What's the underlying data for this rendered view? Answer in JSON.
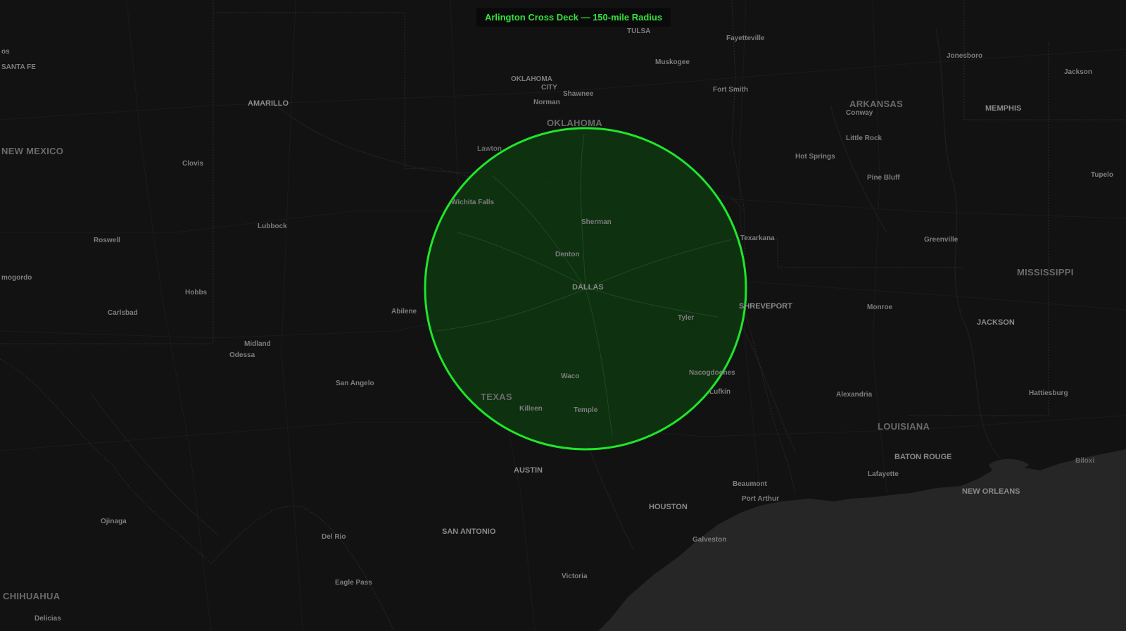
{
  "map": {
    "title": "Arlington Cross Deck — 150-mile Radius",
    "radius_label": "150-mile Radius",
    "center_place": "Arlington",
    "colors": {
      "background": "#121212",
      "gulf_water": "#2a2a2a",
      "circle_stroke": "#1fe62a",
      "circle_fill": "#0d3a0f",
      "title_text": "#35e23c",
      "label_text": "#7d7d7d"
    },
    "state_labels": {
      "new_mexico": "NEW MEXICO",
      "oklahoma": "OKLAHOMA",
      "arkansas": "ARKANSAS",
      "mississippi": "MISSISSIPPI",
      "texas": "TEXAS",
      "louisiana": "LOUISIANA",
      "chihuahua": "CHIHUAHUA"
    },
    "city_labels": {
      "santa_fe": "SANTA FE",
      "los": "os",
      "tulsa": "TULSA",
      "fayetteville": "Fayetteville",
      "jonesboro": "Jonesboro",
      "jackson_tn": "Jackson",
      "oklahoma_city_1": "OKLAHOMA",
      "oklahoma_city_2": "CITY",
      "shawnee": "Shawnee",
      "muskogee": "Muskogee",
      "norman": "Norman",
      "fort_smith": "Fort Smith",
      "amarillo": "AMARILLO",
      "conway": "Conway",
      "memphis": "MEMPHIS",
      "lawton": "Lawton",
      "little_rock": "Little Rock",
      "clovis": "Clovis",
      "hot_springs": "Hot Springs",
      "tupelo": "Tupelo",
      "pine_bluff": "Pine Bluff",
      "wichita_falls": "Wichita Falls",
      "sherman": "Sherman",
      "lubbock": "Lubbock",
      "texarkana": "Texarkana",
      "greenville": "Greenville",
      "roswell": "Roswell",
      "denton": "Denton",
      "alamogordo": "mogordo",
      "dallas": "DALLAS",
      "hobbs": "Hobbs",
      "shreveport": "SHREVEPORT",
      "monroe": "Monroe",
      "jackson_ms": "JACKSON",
      "carlsbad": "Carlsbad",
      "abilene": "Abilene",
      "tyler": "Tyler",
      "midland": "Midland",
      "odessa": "Odessa",
      "waco": "Waco",
      "nacogdoches": "Nacogdoches",
      "san_angelo": "San Angelo",
      "lufkin": "Lufkin",
      "alexandria": "Alexandria",
      "hattiesburg": "Hattiesburg",
      "killeen": "Killeen",
      "temple": "Temple",
      "baton_rouge": "BATON ROUGE",
      "biloxi": "Biloxi",
      "austin": "AUSTIN",
      "lafayette": "Lafayette",
      "beaumont": "Beaumont",
      "new_orleans": "NEW ORLEANS",
      "port_arthur": "Port Arthur",
      "houston": "HOUSTON",
      "ojinaga": "Ojinaga",
      "galveston": "Galveston",
      "del_rio": "Del Rio",
      "san_antonio": "SAN ANTONIO",
      "victoria": "Victoria",
      "eagle_pass": "Eagle Pass",
      "delicias": "Delicias"
    }
  }
}
